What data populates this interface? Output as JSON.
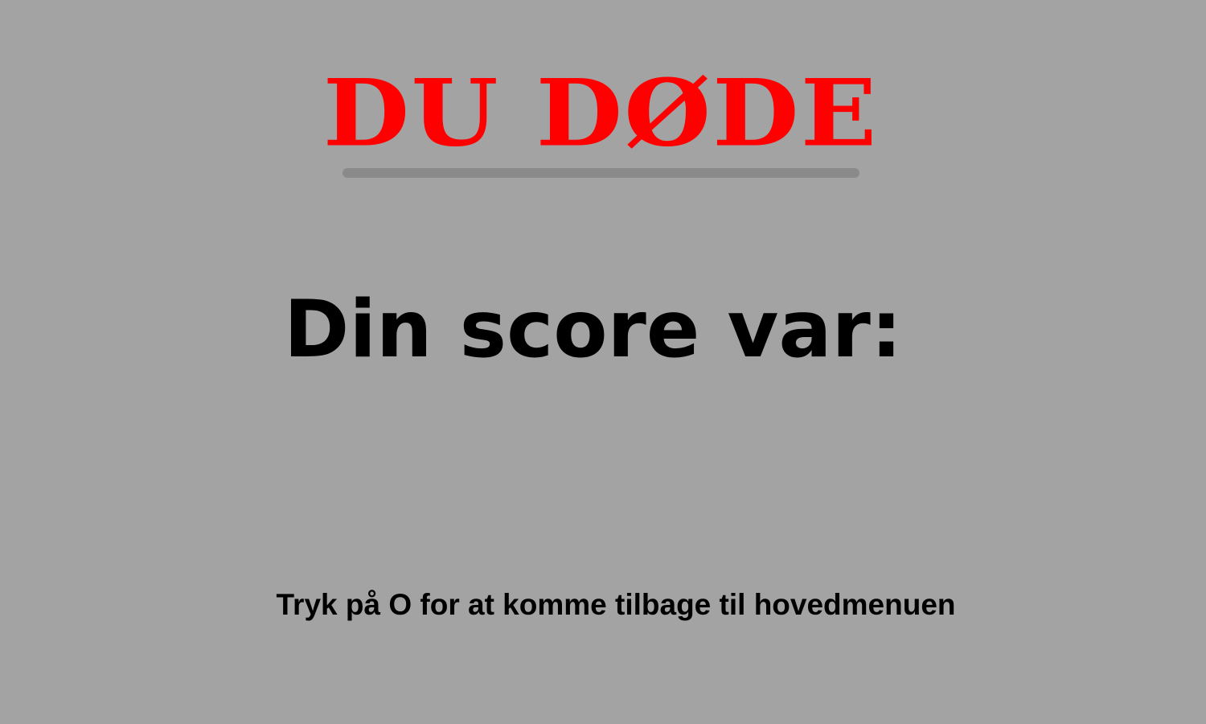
{
  "game_over": {
    "title": "DU DØDE",
    "score_label": "Din score var:",
    "score_value": "",
    "hint": "Tryk på O for at komme tilbage til hovedmenuen"
  },
  "colors": {
    "background": "#a3a3a3",
    "title": "#ff0000",
    "title_shadow": "#8a8a8a",
    "text": "#000000"
  }
}
